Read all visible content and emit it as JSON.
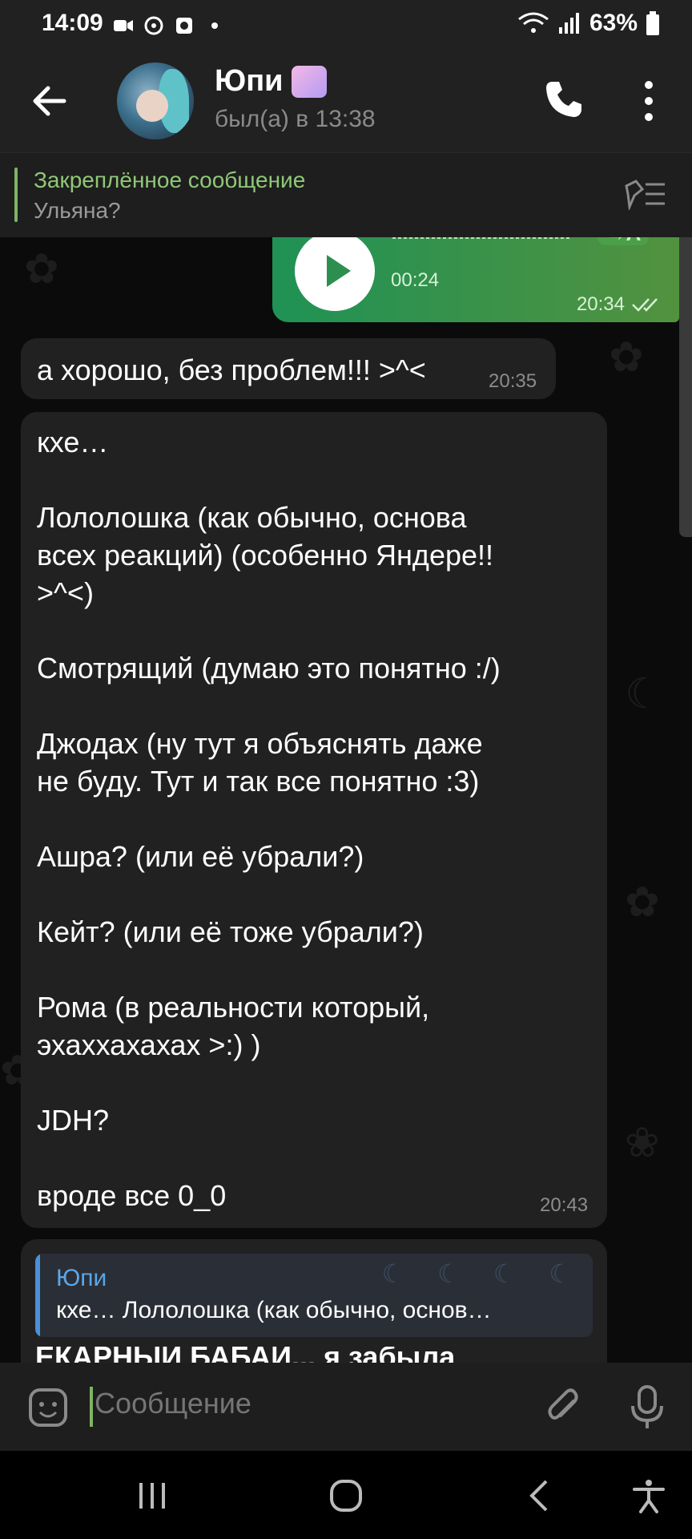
{
  "status_bar": {
    "time": "14:09",
    "battery": "63%"
  },
  "header": {
    "contact_name": "Юпи",
    "last_seen": "был(а) в 13:38"
  },
  "pinned": {
    "title": "Закреплённое сообщение",
    "text": "Ульяна?"
  },
  "voice_message": {
    "duration": "00:24",
    "time": "20:34",
    "transcribe_label": "→A"
  },
  "messages": [
    {
      "text": "а хорошо, без проблем!!! >^<",
      "time": "20:35"
    },
    {
      "text": "кхе…\n\nЛололошка (как обычно, основа\nвсех реакций) (особенно Яндере!!\n>^<)\n\nСмотрящий (думаю это понятно :/)\n\nДжодах (ну тут я объяснять даже\nне буду. Тут и так все понятно :3)\n\nАшра? (или её убрали?)\n\nКейт? (или её тоже убрали?)\n\nРома (в реальности который,\nэхаххахахах >:) )\n\nJDH?\n\nвроде все 0_0",
      "time": "20:43"
    }
  ],
  "reply_preview": {
    "name": "Юпи",
    "text": "кхе…  Лололошка (как обычно, основ…",
    "partial_text": "ЕКАРНЫЙ БАБАЙ... я забыла"
  },
  "composer": {
    "placeholder": "Сообщение"
  }
}
